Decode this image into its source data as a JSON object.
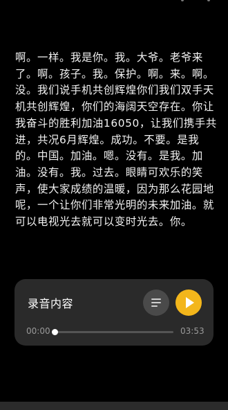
{
  "transcript": {
    "text": "啊。一样。我是你。我。大爷。老爷来了。啊。孩子。我。保护。啊。来。啊。没。我们说手机共创辉煌你们我们双手天机共创辉煌，你们的海阔天空存在。你让我奋斗的胜利加油16050，让我们携手共进，共况6月辉煌。成功。不要。是我的。中国。加油。嗯。没有。是我。加油。没有。我。过去。眼睛可欢乐的笑声，使大家成绩的温暖，因为那么花园地呢，一个让你们非常光明的未来加油。就可以电视光去就可以变时光去。你。"
  },
  "player": {
    "title": "录音内容",
    "current_time": "00:00",
    "total_time": "03:53",
    "progress": 0.0,
    "menu_icon": "list-lines-icon",
    "play_icon": "play-icon",
    "accent_color": "#f3b61b"
  }
}
